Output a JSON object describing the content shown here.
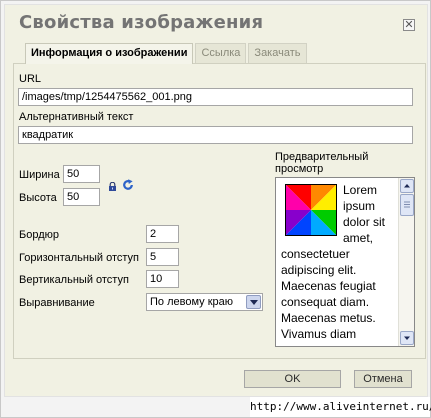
{
  "dialog": {
    "title": "Свойства изображения",
    "close_symbol": "✕",
    "tabs": [
      {
        "label": "Информация о изображении",
        "active": true
      },
      {
        "label": "Ссылка",
        "active": false
      },
      {
        "label": "Закачать",
        "active": false
      }
    ]
  },
  "form": {
    "url_label": "URL",
    "url_value": "/images/tmp/1254475562_001.png",
    "alt_label": "Альтернативный текст",
    "alt_value": "квадратик",
    "width_label": "Ширина",
    "width_value": "50",
    "height_label": "Высота",
    "height_value": "50",
    "border_label": "Бордюр",
    "border_value": "2",
    "hspace_label": "Горизонтальный отступ",
    "hspace_value": "5",
    "vspace_label": "Вертикальный отступ",
    "vspace_value": "10",
    "align_label": "Выравнивание",
    "align_value": "По левому краю"
  },
  "preview": {
    "label_line1": "Предварительный",
    "label_line2": "просмотр",
    "text": "Lorem ipsum dolor sit amet, consectetuer adipiscing elit. Maecenas feugiat consequat diam. Maecenas metus. Vivamus diam",
    "image_colors": [
      "#ff0000",
      "#ff8800",
      "#ffee00",
      "#00cc00",
      "#00aaff",
      "#0044ff",
      "#8800cc",
      "#ff00aa"
    ]
  },
  "buttons": {
    "ok": "OK",
    "cancel": "Отмена"
  },
  "watermark": "http://www.aliveinternet.ru/"
}
